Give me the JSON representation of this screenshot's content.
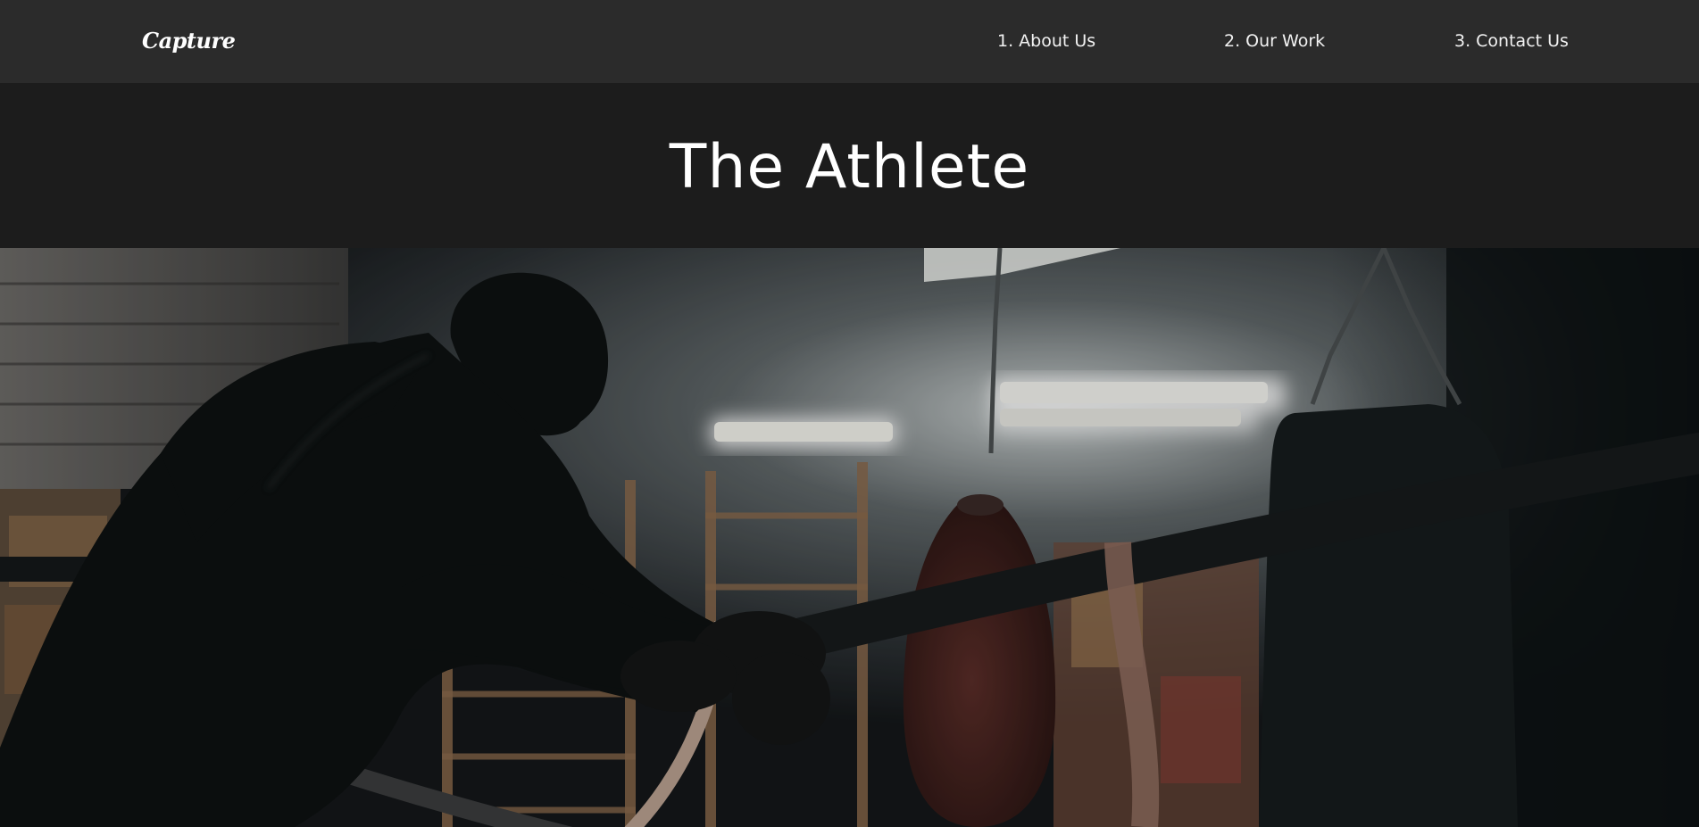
{
  "nav": {
    "logo": "Capture",
    "links": [
      {
        "label": "1. About Us"
      },
      {
        "label": "2. Our Work"
      },
      {
        "label": "3. Contact Us"
      }
    ]
  },
  "hero": {
    "title": "The Athlete",
    "image_icon": "boxing-gym-photo"
  },
  "colors": {
    "nav_background": "#2b2b2b",
    "header_background": "#1c1c1c",
    "text": "#ffffff"
  }
}
